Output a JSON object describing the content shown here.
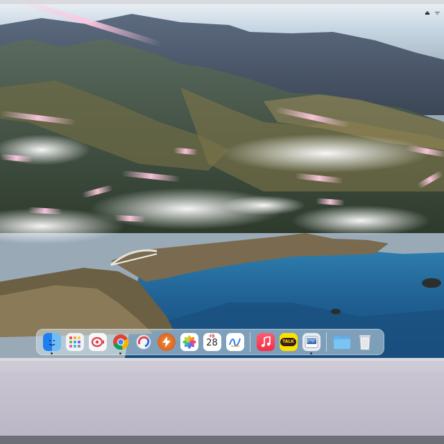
{
  "menu_bar": {
    "items": [
      "",
      "",
      "⏏",
      "ᯤ"
    ]
  },
  "desktop": {
    "wallpaper": "coastal-mountains-wallpaper"
  },
  "calendar_icon": {
    "month": "4월",
    "day": "28"
  },
  "kakaotalk_icon": {
    "label": "TALK"
  },
  "dock": {
    "apps": [
      {
        "name": "finder-icon",
        "color": "#2c8ef8"
      },
      {
        "name": "launchpad-icon",
        "color": "#f2f2f4"
      },
      {
        "name": "pinpoint-icon",
        "color": "#f7f7f7"
      },
      {
        "name": "chrome-icon",
        "color": "#ffffff"
      },
      {
        "name": "cleanmymac-icon",
        "color": "#eeeeee"
      },
      {
        "name": "spark-icon",
        "color": "#e9752a"
      },
      {
        "name": "photos-icon",
        "color": "#ffffff"
      },
      {
        "name": "calendar-icon",
        "color": "#ffffff"
      },
      {
        "name": "freeform-icon",
        "color": "#ffffff"
      },
      {
        "name": "music-icon",
        "color": "#fa3b55"
      },
      {
        "name": "kakaotalk-icon",
        "color": "#fae100"
      },
      {
        "name": "preview-icon",
        "color": "#e8ecf2"
      },
      {
        "name": "downloads-folder-icon",
        "color": "#5fb2f0"
      },
      {
        "name": "trash-icon",
        "color": "#e4e6ea"
      }
    ]
  }
}
